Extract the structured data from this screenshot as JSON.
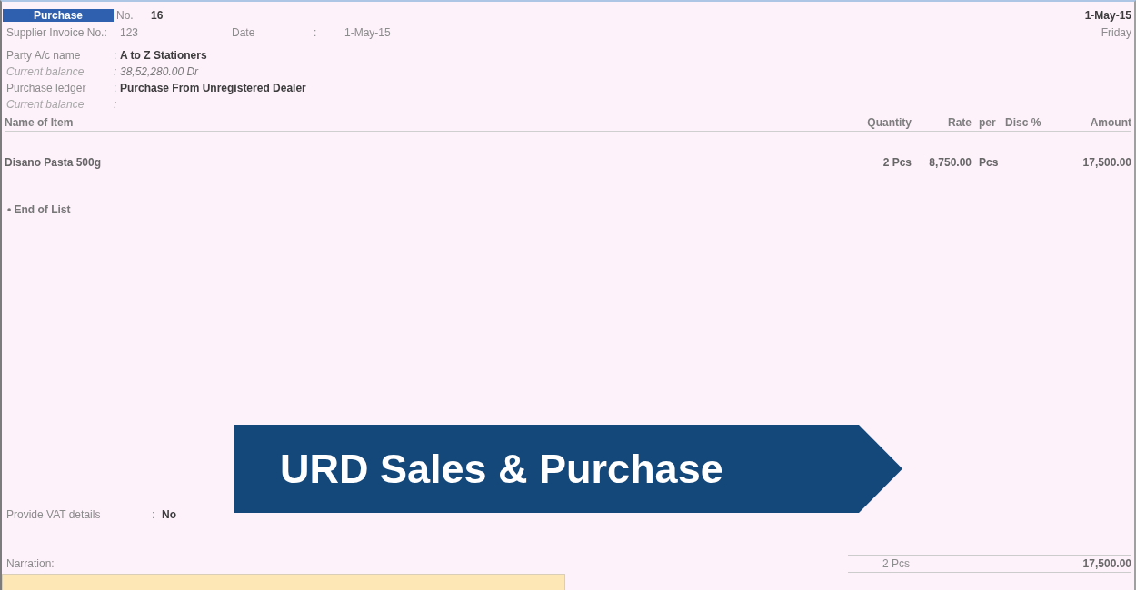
{
  "voucher": {
    "type": "Purchase",
    "number_label": "No.",
    "number": "16",
    "date": "1-May-15",
    "day": "Friday"
  },
  "supplier_invoice": {
    "label": "Supplier Invoice No.:",
    "value": "123",
    "date_label": "Date",
    "separator": ":",
    "date": "1-May-15"
  },
  "ledger_fields": [
    {
      "kind": "main",
      "label": "Party A/c name",
      "separator": ":",
      "value": "A to Z Stationers"
    },
    {
      "kind": "balance",
      "label": "Current balance",
      "separator": ":",
      "value": "38,52,280.00 Dr"
    },
    {
      "kind": "main",
      "label": "Purchase ledger",
      "separator": ":",
      "value": "Purchase From Unregistered Dealer"
    },
    {
      "kind": "balance",
      "label": "Current balance",
      "separator": ":"
    }
  ],
  "items_table": {
    "columns": [
      "Name of Item",
      "Quantity",
      "Rate",
      "per",
      "Disc %",
      "Amount"
    ],
    "rows": [
      {
        "name": "Disano Pasta 500g",
        "quantity": "2 Pcs",
        "rate": "8,750.00",
        "per": "Pcs",
        "amount": "17,500.00"
      }
    ],
    "end_of_list": "• End of List"
  },
  "vat": {
    "label": "Provide VAT details",
    "separator": ":",
    "value": "No"
  },
  "narration": {
    "label": "Narration:"
  },
  "totals": {
    "quantity": "2 Pcs",
    "amount": "17,500.00"
  },
  "banner": {
    "title": "URD Sales & Purchase"
  }
}
